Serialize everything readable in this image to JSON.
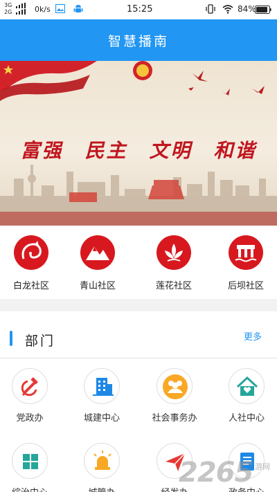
{
  "status_bar": {
    "network_top": "3G",
    "network_bottom": "2G",
    "speed": "0k/s",
    "time": "15:25",
    "battery": "84%",
    "icons": [
      "signal-bars-icon",
      "image-icon",
      "android-icon",
      "vibrate-icon",
      "wifi-icon",
      "battery-icon"
    ]
  },
  "header": {
    "title": "智慧播南",
    "color": "#2196f3"
  },
  "banner": {
    "slogan": [
      "富强",
      "民主",
      "文明",
      "和谐"
    ],
    "accent_color": "#c0161f"
  },
  "communities": [
    {
      "label": "白龙社区",
      "icon": "dragon-icon"
    },
    {
      "label": "青山社区",
      "icon": "mountain-icon"
    },
    {
      "label": "莲花社区",
      "icon": "lotus-icon"
    },
    {
      "label": "后坝社区",
      "icon": "dam-icon"
    }
  ],
  "departments_section": {
    "title": "部门",
    "more": "更多"
  },
  "departments": [
    {
      "label": "党政办",
      "icon": "hammer-sickle-icon",
      "color": "#e53935"
    },
    {
      "label": "城建中心",
      "icon": "building-icon",
      "color": "#1e88e5"
    },
    {
      "label": "社会事务办",
      "icon": "people-icon",
      "color": "#f9a825"
    },
    {
      "label": "人社中心",
      "icon": "home-heart-icon",
      "color": "#26a69a"
    },
    {
      "label": "综治中心",
      "icon": "grid-icon",
      "color": "#26a69a"
    },
    {
      "label": "城管办",
      "icon": "alarm-light-icon",
      "color": "#f9a825"
    },
    {
      "label": "经发办",
      "icon": "send-icon",
      "color": "#e53935"
    },
    {
      "label": "政务中心",
      "icon": "document-icon",
      "color": "#1e88e5"
    }
  ],
  "watermark": {
    "text": "2265",
    "sub": "游网"
  }
}
